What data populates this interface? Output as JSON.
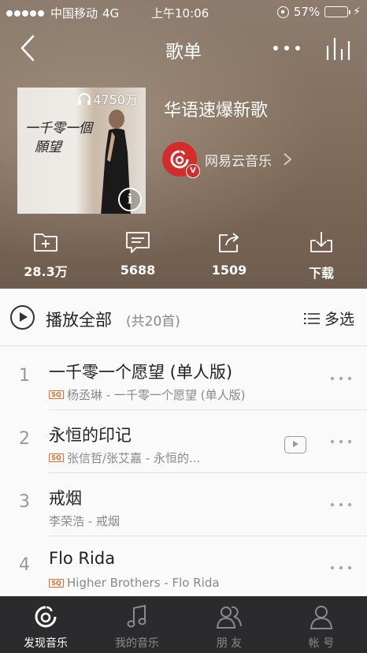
{
  "status_bar": {
    "carrier": "中国移动",
    "network": "4G",
    "time": "上午10:06",
    "battery_percent": "57%",
    "battery_level": 0.57
  },
  "nav": {
    "title": "歌单"
  },
  "playlist": {
    "cover_text": "一千零一個願望",
    "play_count": "4750万",
    "title": "华语速爆新歌",
    "creator": "网易云音乐"
  },
  "actions": [
    {
      "label": "28.3万",
      "icon": "folder-add-icon"
    },
    {
      "label": "5688",
      "icon": "comment-icon"
    },
    {
      "label": "1509",
      "icon": "share-icon"
    },
    {
      "label": "下载",
      "icon": "download-icon"
    }
  ],
  "list_header": {
    "play_all": "播放全部",
    "count": "(共20首)",
    "multi_select": "多选"
  },
  "songs": [
    {
      "num": "1",
      "title": "一千零一个愿望 (单人版)",
      "sub": "杨丞琳 - 一千零一个愿望 (单人版)",
      "sq": true,
      "mv": false
    },
    {
      "num": "2",
      "title": "永恒的印记",
      "sub": "张信哲/张艾嘉 - 永恒的...",
      "sq": true,
      "mv": true
    },
    {
      "num": "3",
      "title": "戒烟",
      "sub": "李荣浩 - 戒烟",
      "sq": false,
      "mv": false
    },
    {
      "num": "4",
      "title": "Flo Rida",
      "sub": "Higher Brothers - Flo Rida",
      "sq": true,
      "mv": false
    }
  ],
  "sq_badge": "SQ",
  "tabs": [
    {
      "label": "发现音乐",
      "icon": "netease-music-icon",
      "active": true
    },
    {
      "label": "我的音乐",
      "icon": "music-note-icon",
      "active": false
    },
    {
      "label": "朋 友",
      "icon": "friends-icon",
      "active": false
    },
    {
      "label": "帐 号",
      "icon": "account-icon",
      "active": false
    }
  ],
  "colors": {
    "brand_red": "#d42b2b",
    "tabbar_bg": "#2b2b2d",
    "sq_orange": "#e36b2b"
  }
}
